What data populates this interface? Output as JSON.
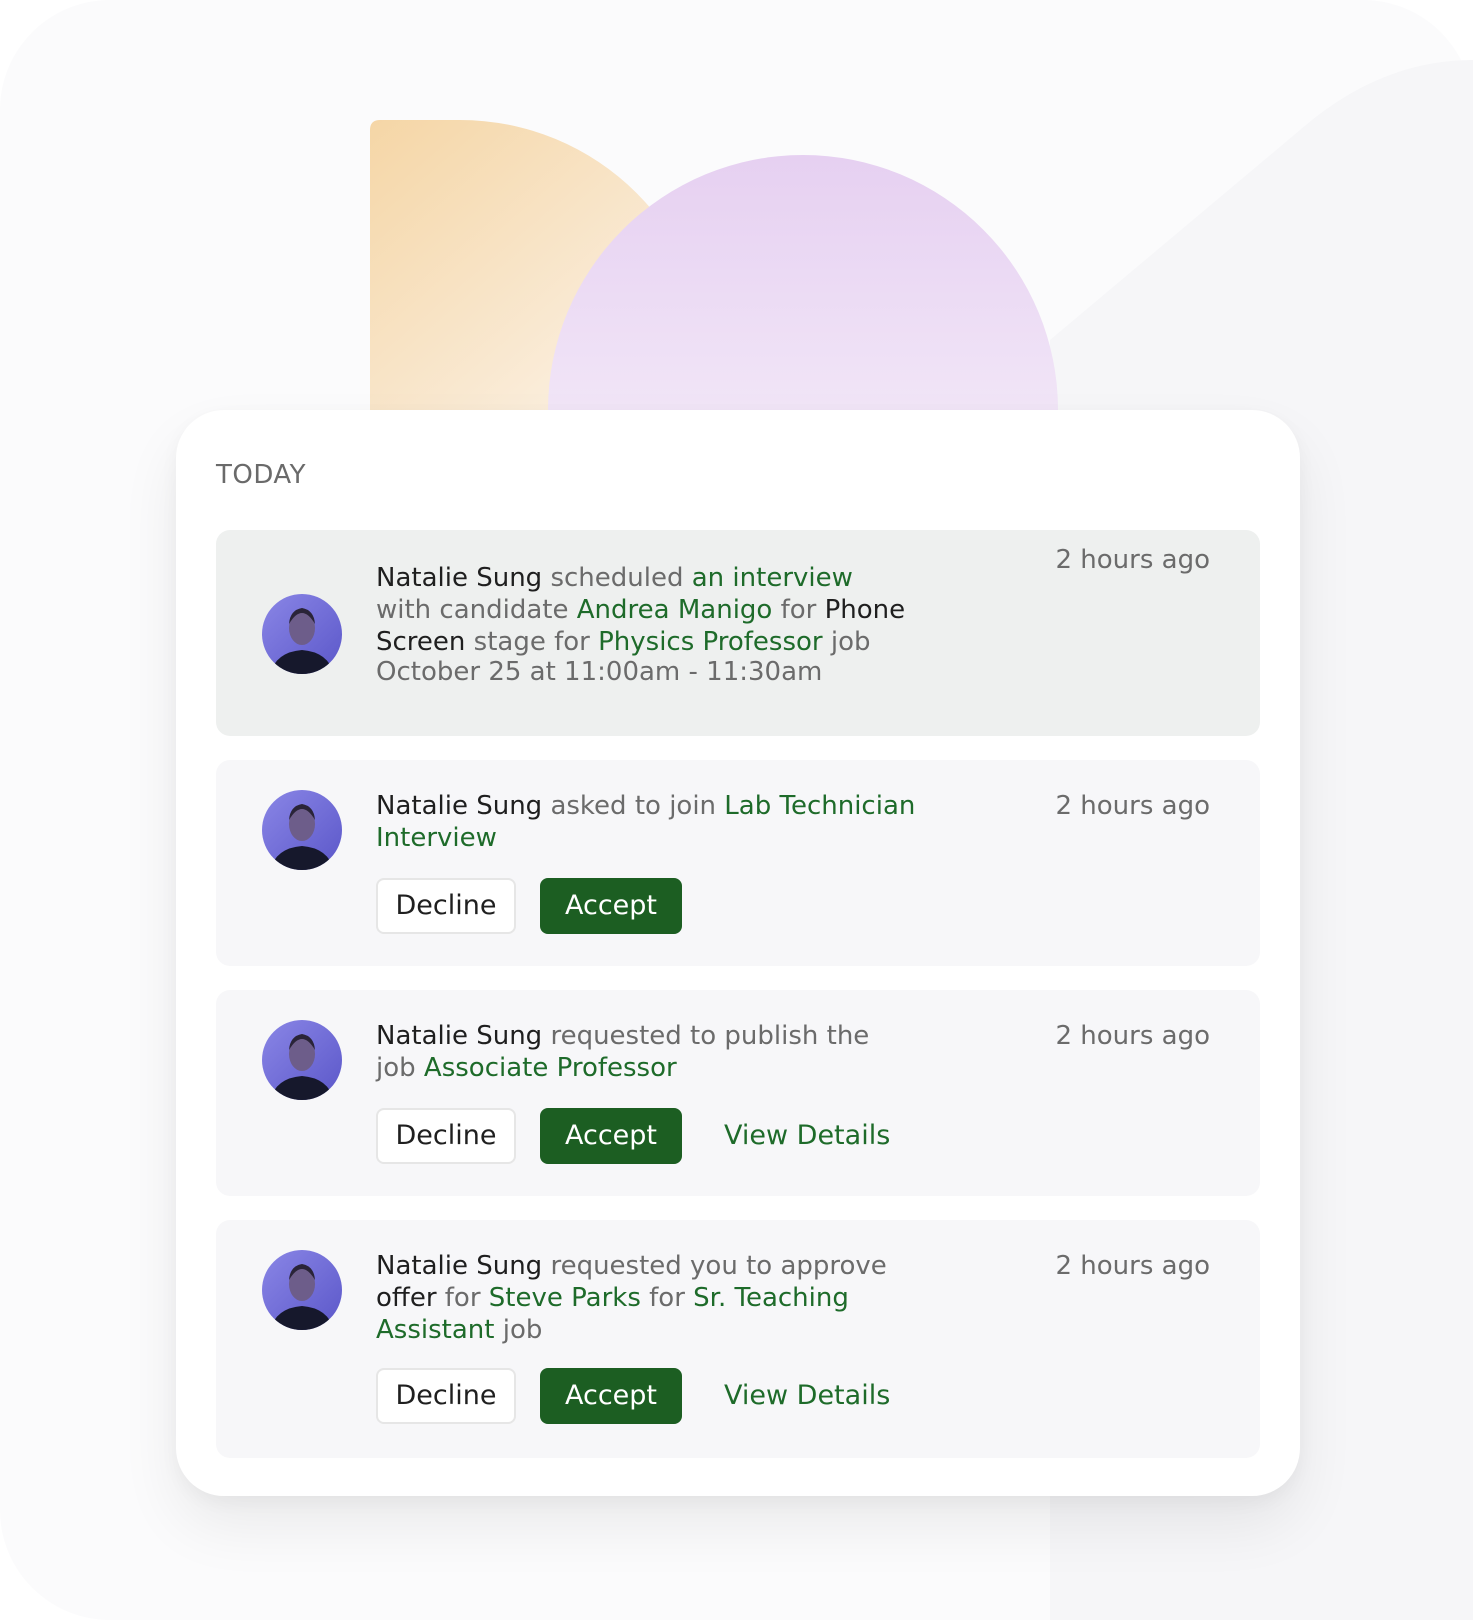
{
  "colors": {
    "accent_green": "#1c5e22",
    "link_green": "#1e6b2a",
    "muted_text": "#6b6b6b",
    "dark_text": "#1f1f1f",
    "deco_orange": "#f6dcb3",
    "deco_purple": "#e9d6f2"
  },
  "section": {
    "label": "TODAY"
  },
  "notifications": [
    {
      "actor": "Natalie Sung",
      "t1": " scheduled ",
      "l1": "an interview",
      "t2": " with candidate ",
      "l2": "Andrea Manigo",
      "t3": " for ",
      "d1": "Phone Screen",
      "t4": " stage for ",
      "l3": "Physics Professor",
      "t5": " job",
      "meta": "October 25 at 11:00am - 11:30am",
      "time": "2 hours ago"
    },
    {
      "actor": "Natalie Sung",
      "t1": " asked to join ",
      "l1": "Lab Technician Interview",
      "time": "2 hours ago",
      "decline": "Decline",
      "accept": "Accept"
    },
    {
      "actor": "Natalie Sung",
      "t1": " requested to publish the job ",
      "l1": "Associate Professor",
      "time": "2 hours ago",
      "decline": "Decline",
      "accept": "Accept",
      "details": "View Details"
    },
    {
      "actor": "Natalie Sung",
      "t1": " requested you to approve ",
      "d1": "offer",
      "t2": " for ",
      "l1": "Steve Parks",
      "t3": " for ",
      "l2": "Sr. Teaching Assistant",
      "t4": " job",
      "time": "2 hours ago",
      "decline": "Decline",
      "accept": "Accept",
      "details": "View Details"
    }
  ]
}
